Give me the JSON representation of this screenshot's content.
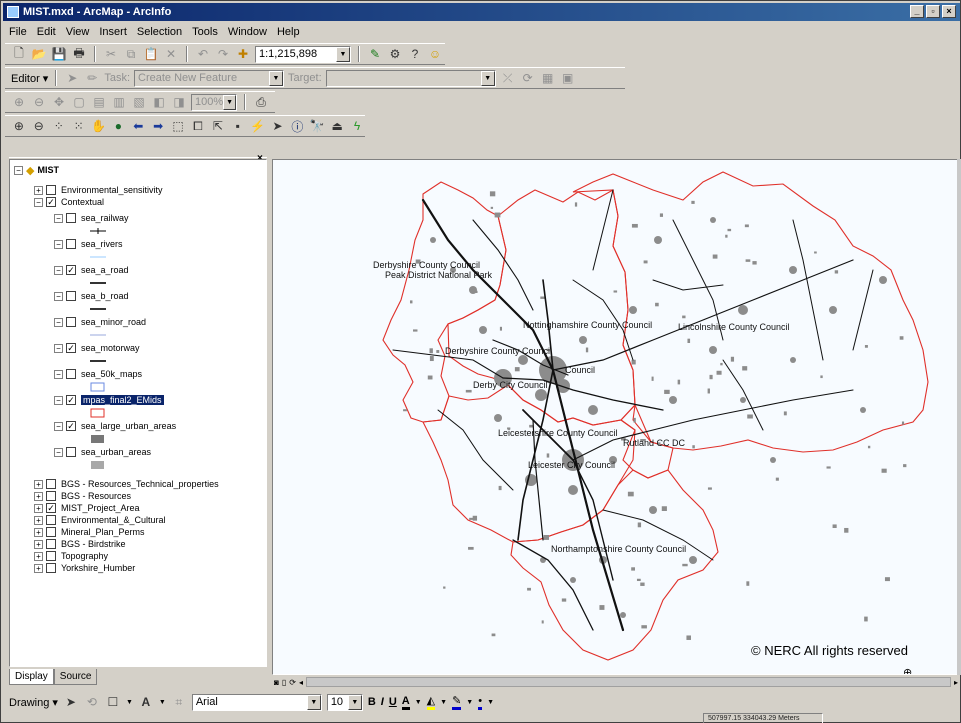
{
  "window": {
    "title": "MIST.mxd - ArcMap - ArcInfo",
    "controls": [
      "_",
      "×"
    ]
  },
  "menu": [
    "File",
    "Edit",
    "View",
    "Insert",
    "Selection",
    "Tools",
    "Window",
    "Help"
  ],
  "standard_toolbar": {
    "scale": "1:1,215,898"
  },
  "editor_toolbar": {
    "editor_label": "Editor",
    "task_label": "Task:",
    "task_value": "Create New Feature",
    "target_label": "Target:",
    "target_value": ""
  },
  "layout_toolbar": {
    "zoom_value": "100%"
  },
  "toc": {
    "root": "MIST",
    "layers": [
      {
        "name": "Environmental_sensitivity",
        "checked": false,
        "expanded": false
      },
      {
        "name": "Contextual",
        "checked": true,
        "expanded": true
      }
    ],
    "contextual_children": [
      {
        "name": "sea_railway",
        "checked": false,
        "symbol": "railway"
      },
      {
        "name": "sea_rivers",
        "checked": false,
        "symbol": "river"
      },
      {
        "name": "sea_a_road",
        "checked": true,
        "symbol": "a-road"
      },
      {
        "name": "sea_b_road",
        "checked": false,
        "symbol": "b-road"
      },
      {
        "name": "sea_minor_road",
        "checked": false,
        "symbol": "minor-road"
      },
      {
        "name": "sea_motorway",
        "checked": true,
        "symbol": "motorway"
      },
      {
        "name": "sea_50k_maps",
        "checked": false,
        "symbol": "box-blue"
      },
      {
        "name": "mpas_final2_EMids",
        "checked": true,
        "symbol": "box-red",
        "selected": true
      },
      {
        "name": "sea_large_urban_areas",
        "checked": true,
        "symbol": "fill-gray-dark"
      },
      {
        "name": "sea_urban_areas",
        "checked": false,
        "symbol": "fill-gray-light"
      }
    ],
    "other_groups": [
      {
        "name": "BGS - Resources_Technical_properties",
        "checked": false
      },
      {
        "name": "BGS - Resources",
        "checked": false
      },
      {
        "name": "MIST_Project_Area",
        "checked": true
      },
      {
        "name": "Environmental_&_Cultural",
        "checked": false
      },
      {
        "name": "Mineral_Plan_Perms",
        "checked": false
      },
      {
        "name": "BGS - Birdstrike",
        "checked": false
      },
      {
        "name": "Topography",
        "checked": false
      },
      {
        "name": "Yorkshire_Humber",
        "checked": false
      }
    ],
    "tabs": [
      "Display",
      "Source"
    ]
  },
  "map": {
    "labels": [
      "Derbyshire County Council",
      "Peak District National Park",
      "Nottinghamshire County Council",
      "Lincolnshire County Council",
      "Derbyshire County Council",
      "Derby City Council",
      "Council",
      "Leicestershire County Council",
      "Rutland CC DC",
      "Leicester City Council",
      "Northamptonshire County Council"
    ],
    "copyright": "© NERC All rights reserved",
    "colors": {
      "boundary": "#e0302a",
      "road": "#111111",
      "urban": "#8c8c8c"
    }
  },
  "drawing_toolbar": {
    "drawing_label": "Drawing",
    "font": "Arial",
    "size": "10",
    "bold": "B",
    "italic": "I",
    "underline": "U"
  },
  "status": {
    "coordinates": "507997.15 334043.29 Meters"
  }
}
